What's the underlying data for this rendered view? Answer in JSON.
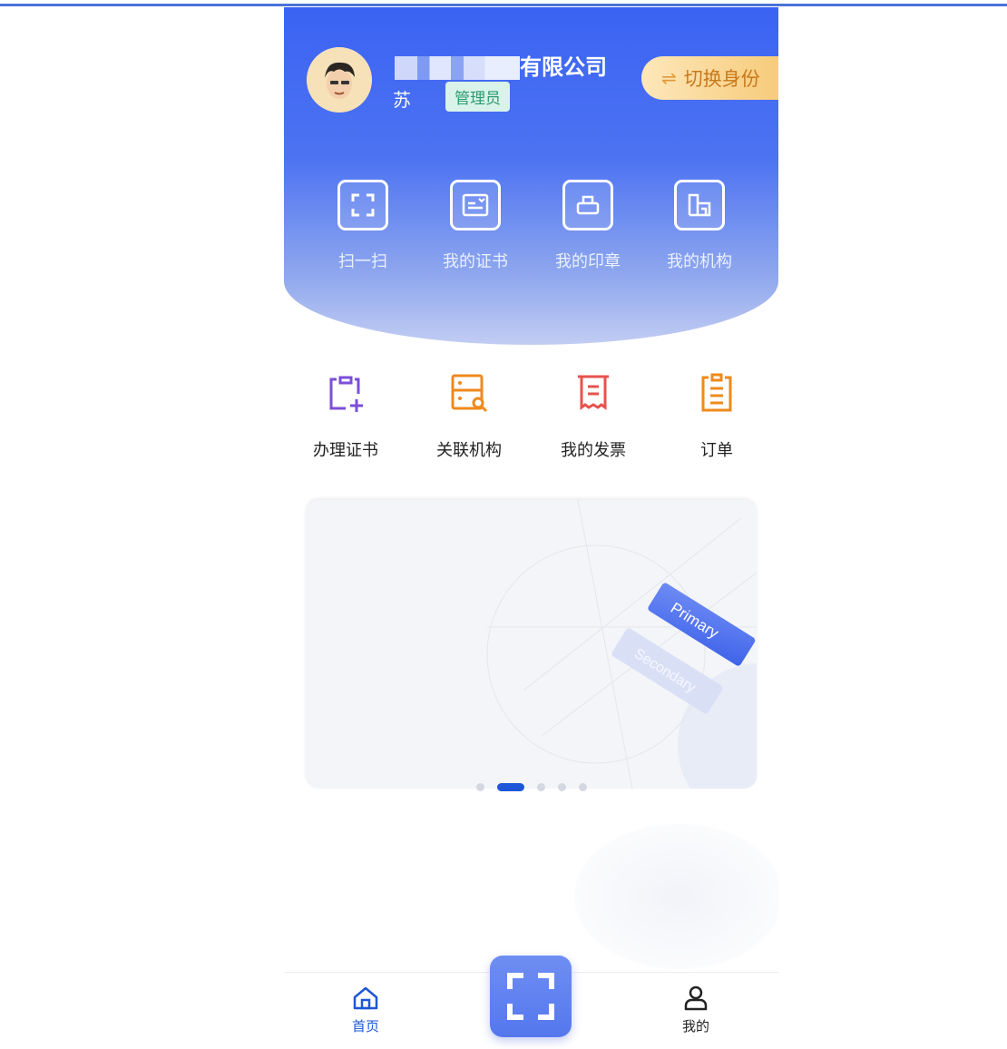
{
  "header": {
    "company_name_suffix": "有限公司",
    "person_name": "苏",
    "role_badge": "管理员",
    "switch_identity_label": "切换身份"
  },
  "quick_actions": [
    {
      "label": "扫一扫",
      "icon": "scan-icon"
    },
    {
      "label": "我的证书",
      "icon": "certificate-icon"
    },
    {
      "label": "我的印章",
      "icon": "seal-icon"
    },
    {
      "label": "我的机构",
      "icon": "organization-icon"
    }
  ],
  "services": [
    {
      "label": "办理证书",
      "icon": "apply-certificate-icon",
      "color": "#7b4fd9"
    },
    {
      "label": "关联机构",
      "icon": "link-organization-icon",
      "color": "#ef8a1c"
    },
    {
      "label": "我的发票",
      "icon": "invoice-icon",
      "color": "#e8524d"
    },
    {
      "label": "订单",
      "icon": "order-icon",
      "color": "#ef8a1c"
    }
  ],
  "banner": {
    "primary_tag": "Primary",
    "secondary_tag": "Secondary",
    "active_slide": 2,
    "slide_count": 5
  },
  "tabbar": {
    "home_label": "首页",
    "me_label": "我的",
    "active_color": "#1d56d8"
  }
}
